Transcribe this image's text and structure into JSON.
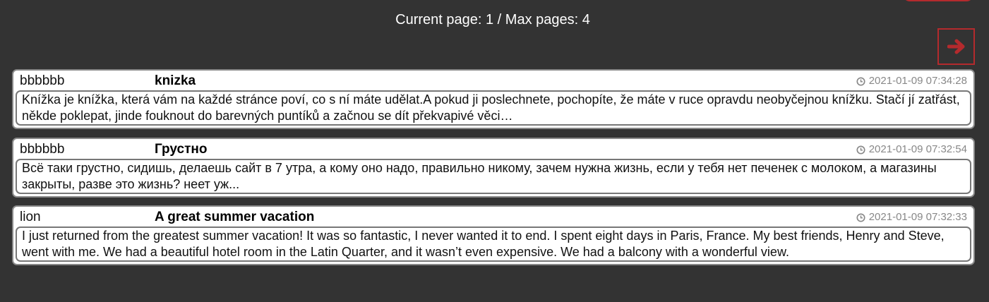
{
  "pagination": {
    "indicator": "Current page: 1 / Max pages: 4",
    "next_icon": "arrow-right-icon"
  },
  "colors": {
    "background": "#333333",
    "accent": "#b42a2d"
  },
  "posts": [
    {
      "author": "bbbbbb",
      "title": "knizka",
      "timestamp": "2021-01-09 07:34:28",
      "body": "Knížka je knížka, která vám na každé stránce poví, co s ní máte udělat.A pokud ji poslechnete, pochopíte, že máte v ruce opravdu neobyčejnou knížku. Stačí jí zatřást, někde poklepat, jinde fouknout do barevných puntíků a začnou se dít překvapivé věci…"
    },
    {
      "author": "bbbbbb",
      "title": "Грустно",
      "timestamp": "2021-01-09 07:32:54",
      "body": "Всё таки грустно, сидишь, делаешь сайт в 7 утра, а кому оно надо, правильно никому, зачем нужна жизнь, если у тебя нет печенек с молоком, а магазины закрыты, разве это жизнь? неет уж..."
    },
    {
      "author": "lion",
      "title": "A great summer vacation",
      "timestamp": "2021-01-09 07:32:33",
      "body": "I just returned from the greatest summer vacation! It was so fantastic, I never wanted it to end. I spent eight days in Paris, France. My best friends, Henry and Steve, went with me. We had a beautiful hotel room in the Latin Quarter, and it wasn’t even expensive. We had a balcony with a wonderful view."
    }
  ]
}
